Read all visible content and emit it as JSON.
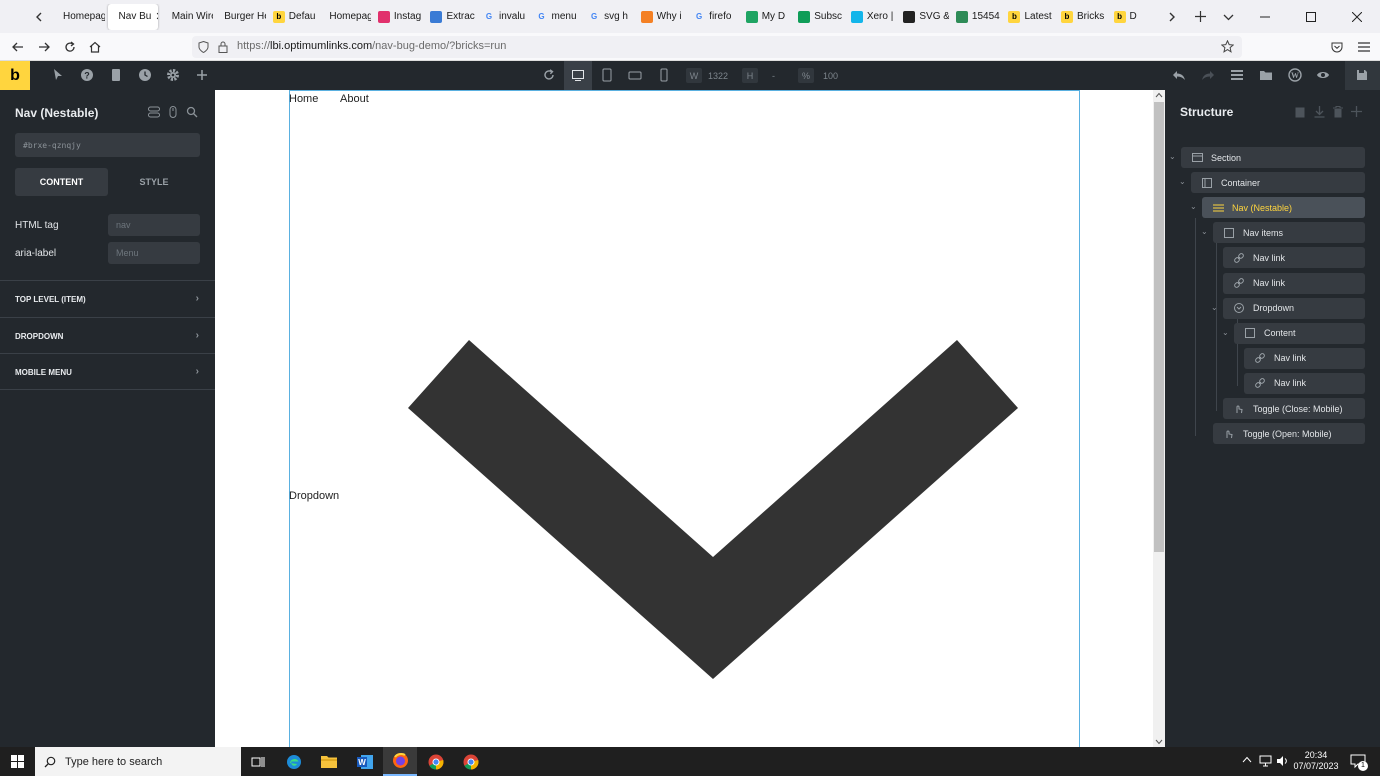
{
  "browser": {
    "tabs": [
      {
        "label": "Homepag",
        "icon": "page-icon",
        "color": "#888888"
      },
      {
        "label": "Nav Bu",
        "icon": "page-icon",
        "color": "#888888",
        "active": true
      },
      {
        "label": "Main Wire",
        "icon": "page-icon",
        "color": "#888888"
      },
      {
        "label": "Burger He",
        "icon": "page-icon",
        "color": "#888888"
      },
      {
        "label": "Defau",
        "icon": "bricks-icon",
        "color": "#ffd53e"
      },
      {
        "label": "Homepag",
        "icon": "page-icon",
        "color": "#888888"
      },
      {
        "label": "Instag",
        "icon": "instagram-icon",
        "color": "#e1306c"
      },
      {
        "label": "Extrac",
        "icon": "extract-icon",
        "color": "#3a7bd5"
      },
      {
        "label": "invalu",
        "icon": "google-icon",
        "color": "#4285f4"
      },
      {
        "label": "menu",
        "icon": "google-icon",
        "color": "#4285f4"
      },
      {
        "label": "svg h",
        "icon": "google-icon",
        "color": "#4285f4"
      },
      {
        "label": "Why i",
        "icon": "stack-icon",
        "color": "#f48024"
      },
      {
        "label": "firefo",
        "icon": "google-icon",
        "color": "#4285f4"
      },
      {
        "label": "My D",
        "icon": "drive-icon",
        "color": "#1fa463"
      },
      {
        "label": "Subsc",
        "icon": "sheets-icon",
        "color": "#0f9d58"
      },
      {
        "label": "Xero |",
        "icon": "xero-icon",
        "color": "#13b5ea"
      },
      {
        "label": "SVG &",
        "icon": "github-icon",
        "color": "#222222"
      },
      {
        "label": "15454",
        "icon": "bug-icon",
        "color": "#2e8b57"
      },
      {
        "label": "Latest",
        "icon": "bricks-icon",
        "color": "#ffd53e"
      },
      {
        "label": "Bricks",
        "icon": "bricks-icon",
        "color": "#ffd53e"
      },
      {
        "label": "D",
        "icon": "bricks-icon",
        "color": "#ffd53e"
      }
    ],
    "url_host": "lbi.optimumlinks.com",
    "url_prefix": "https://",
    "url_path": "/nav-bug-demo/?bricks=run"
  },
  "builder": {
    "logo": "b",
    "width_label": "W",
    "width_value": "1322",
    "height_label": "H",
    "height_value": "-",
    "zoom_label": "%",
    "zoom_value": "100"
  },
  "left_panel": {
    "title": "Nav (Nestable)",
    "element_id": "#brxe-qznqjy",
    "tab_content": "CONTENT",
    "tab_style": "STYLE",
    "fields": [
      {
        "label": "HTML tag",
        "placeholder": "nav"
      },
      {
        "label": "aria-label",
        "placeholder": "Menu"
      }
    ],
    "sections": [
      "TOP LEVEL (ITEM)",
      "DROPDOWN",
      "MOBILE MENU"
    ]
  },
  "canvas": {
    "nav_links": [
      "Home",
      "About"
    ],
    "dropdown_label": "Dropdown",
    "chevron_color": "#333333"
  },
  "structure": {
    "title": "Structure",
    "items": [
      {
        "label": "Section",
        "icon": "section-icon"
      },
      {
        "label": "Container",
        "icon": "container-icon"
      },
      {
        "label": "Nav (Nestable)",
        "icon": "nav-icon",
        "active": true
      },
      {
        "label": "Nav items",
        "icon": "block-icon"
      },
      {
        "label": "Nav link",
        "icon": "link-icon"
      },
      {
        "label": "Nav link",
        "icon": "link-icon"
      },
      {
        "label": "Dropdown",
        "icon": "dropdown-icon"
      },
      {
        "label": "Content",
        "icon": "block-icon"
      },
      {
        "label": "Nav link",
        "icon": "link-icon"
      },
      {
        "label": "Nav link",
        "icon": "link-icon"
      },
      {
        "label": "Toggle (Close: Mobile)",
        "icon": "toggle-icon"
      },
      {
        "label": "Toggle (Open: Mobile)",
        "icon": "toggle-icon"
      }
    ]
  },
  "taskbar": {
    "search_placeholder": "Type here to search",
    "time": "20:34",
    "date": "07/07/2023",
    "notification_count": "1"
  },
  "colors": {
    "bricks_yellow": "#ffd53e",
    "panel_bg": "#23282d",
    "frame_outline": "#5ab0e0"
  }
}
